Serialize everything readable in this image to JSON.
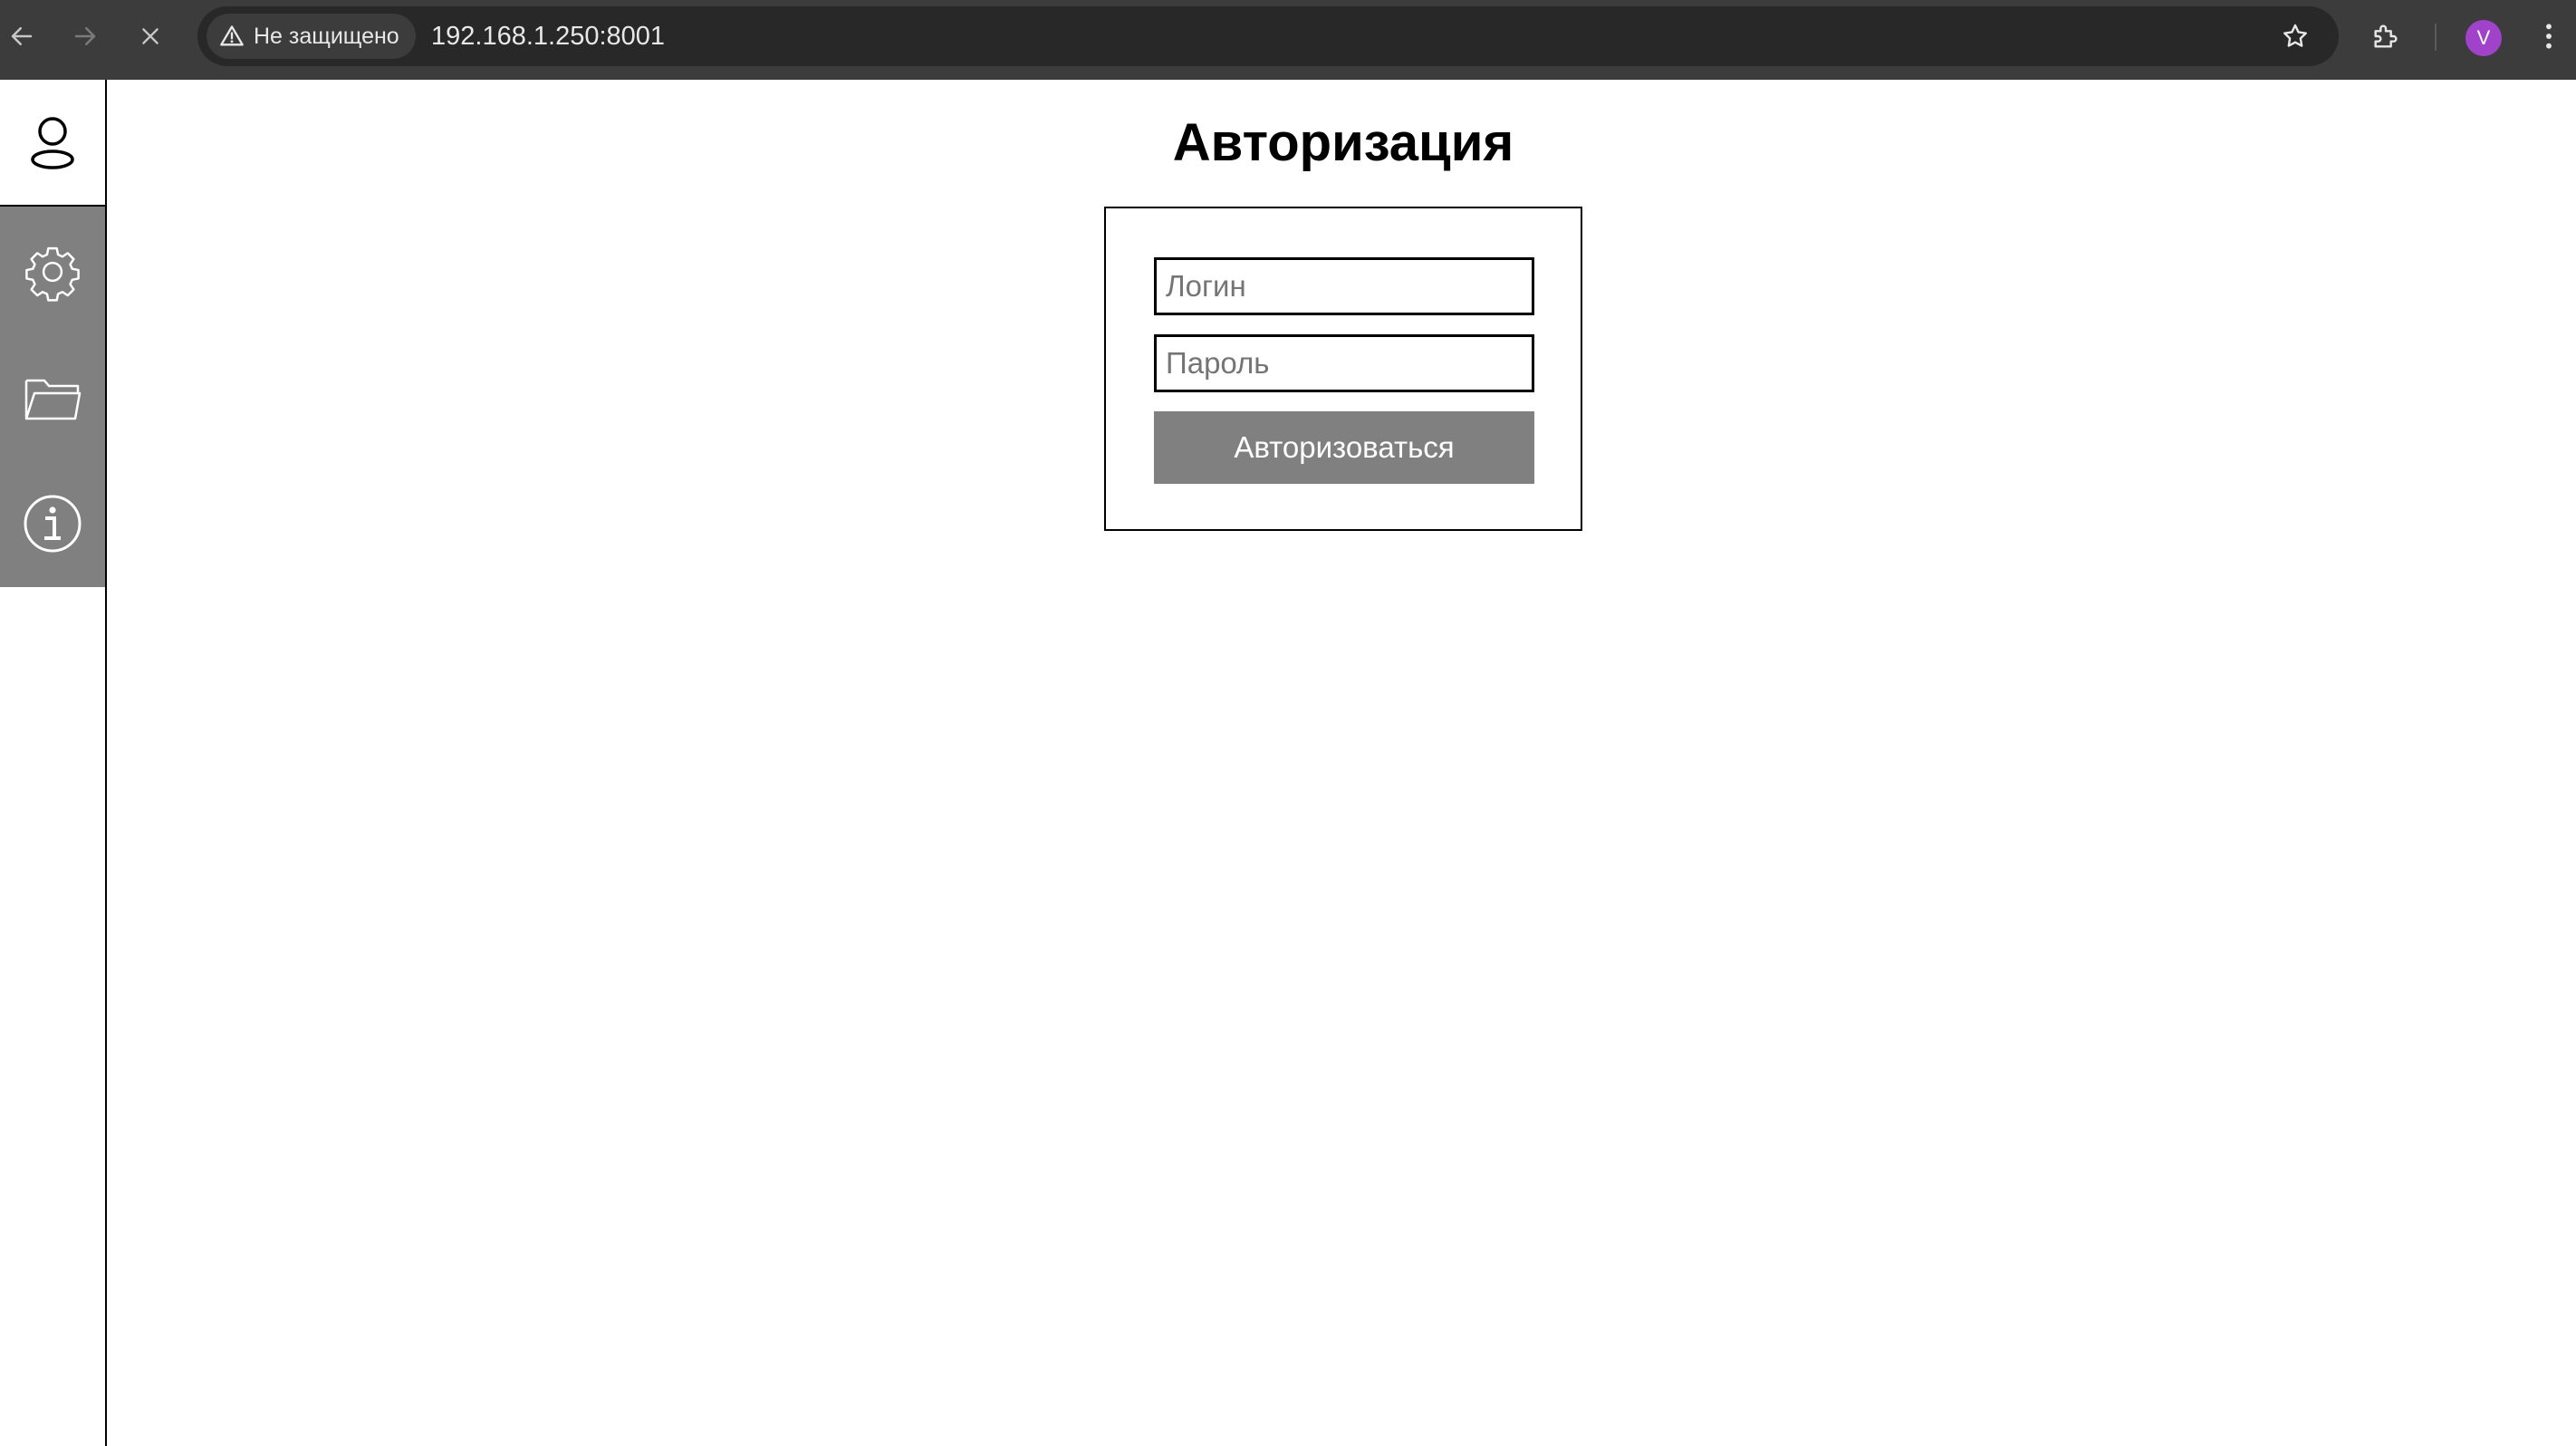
{
  "browser": {
    "security_label": "Не защищено",
    "url": "192.168.1.250:8001",
    "profile_initial": "V",
    "icons": {
      "back": "arrow-left-icon",
      "forward": "arrow-right-icon",
      "stop": "close-icon",
      "warning": "warning-triangle-icon",
      "bookmark": "star-icon",
      "extensions": "puzzle-icon",
      "menu": "more-vert-icon"
    },
    "colors": {
      "chrome": "#3c3c3c",
      "omnibox": "#282828",
      "avatar": "#a142cb"
    }
  },
  "sidebar": {
    "items": [
      {
        "icon": "user-icon"
      },
      {
        "icon": "gear-icon"
      },
      {
        "icon": "folder-icon"
      },
      {
        "icon": "info-icon"
      }
    ],
    "colors": {
      "active_bg": "#808080"
    }
  },
  "auth": {
    "title": "Авторизация",
    "login_placeholder": "Логин",
    "password_placeholder": "Пароль",
    "submit_label": "Авторизоваться"
  }
}
